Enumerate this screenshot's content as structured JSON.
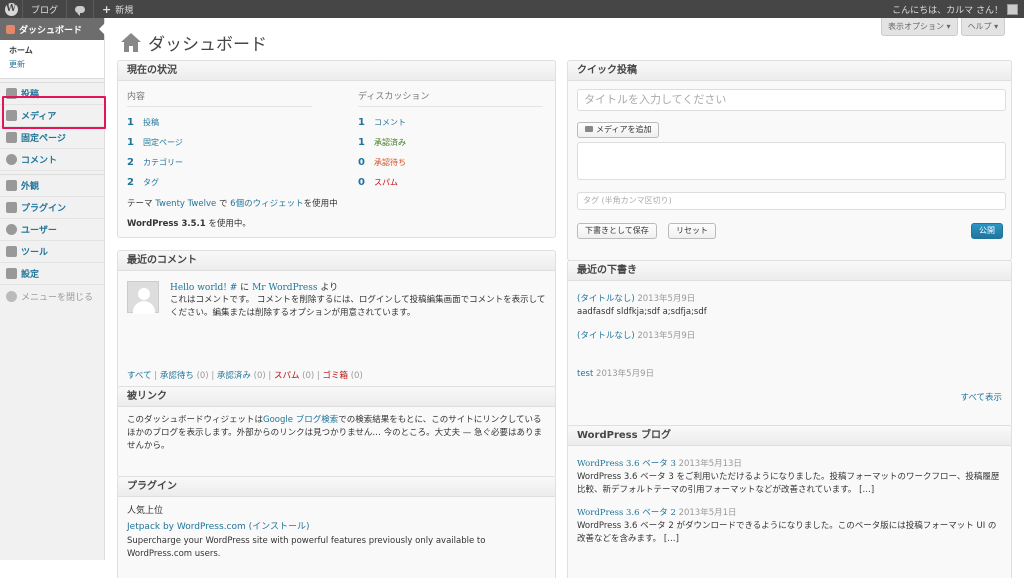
{
  "adminbar": {
    "site_name": "ブログ",
    "new_label": "新規",
    "greeting": "こんにちは、カルマ さん！"
  },
  "sidebar": {
    "current": "ダッシュボード",
    "submenu": [
      "ホーム",
      "更新"
    ],
    "items": [
      {
        "label": "投稿",
        "icon": "pin-icon"
      },
      {
        "label": "メディア",
        "icon": "media-icon"
      },
      {
        "label": "固定ページ",
        "icon": "page-icon"
      },
      {
        "label": "コメント",
        "icon": "comment-icon"
      },
      {
        "label": "外観",
        "icon": "appearance-icon"
      },
      {
        "label": "プラグイン",
        "icon": "plugin-icon"
      },
      {
        "label": "ユーザー",
        "icon": "users-icon"
      },
      {
        "label": "ツール",
        "icon": "tools-icon"
      },
      {
        "label": "設定",
        "icon": "settings-icon"
      }
    ],
    "collapse": "メニューを閉じる"
  },
  "header": {
    "title": "ダッシュボード",
    "screen_options": "表示オプション ▾",
    "help": "ヘルプ ▾"
  },
  "right_now": {
    "title": "現在の状況",
    "content_head": "内容",
    "discussion_head": "ディスカッション",
    "content": [
      {
        "num": "1",
        "label": "投稿"
      },
      {
        "num": "1",
        "label": "固定ページ"
      },
      {
        "num": "2",
        "label": "カテゴリー"
      },
      {
        "num": "2",
        "label": "タグ"
      }
    ],
    "discussion": [
      {
        "num": "1",
        "label": "コメント",
        "color": "#21759b"
      },
      {
        "num": "1",
        "label": "承認済み",
        "color": "#3a7a16"
      },
      {
        "num": "0",
        "label": "承認待ち",
        "color": "#d54e21"
      },
      {
        "num": "0",
        "label": "スパム",
        "color": "#bc0b0b"
      }
    ],
    "theme_prefix": "テーマ",
    "theme_name": "Twenty Twelve",
    "theme_mid": "で",
    "widgets": "6個のウィジェット",
    "theme_suffix": "を使用中",
    "version_bold": "WordPress 3.5.1",
    "version_suffix": "を使用中。"
  },
  "recent_comments": {
    "title": "最近のコメント",
    "post_title": "Hello world! #",
    "ni": "に",
    "author": "Mr WordPress",
    "yori": "より",
    "text": "これはコメントです。 コメントを削除するには、ログインして投稿編集画面でコメントを表示してください。編集または削除するオプションが用意されています。",
    "filters": [
      {
        "label": "すべて",
        "count": "",
        "color": "#21759b"
      },
      {
        "label": "承認待ち",
        "count": "(0)",
        "color": "#21759b"
      },
      {
        "label": "承認済み",
        "count": "(0)",
        "color": "#21759b"
      },
      {
        "label": "スパム",
        "count": "(0)",
        "color": "#bc0b0b"
      },
      {
        "label": "ゴミ箱",
        "count": "(0)",
        "color": "#bc0b0b"
      }
    ]
  },
  "incoming_links": {
    "title": "被リンク",
    "text_a": "このダッシュボードウィジェットは",
    "link": "Google ブログ検索",
    "text_b": "での検索結果をもとに、このサイトにリンクしているほかのブログを表示します。外部からのリンクは見つかりません… 今のところ。大丈夫 — 急ぐ必要はありませんから。"
  },
  "plugins": {
    "title": "プラグイン",
    "section": "人気上位",
    "plugin_name": "Jetpack by WordPress.com",
    "install": "(インストール)",
    "desc": "Supercharge your WordPress site with powerful features previously only available to WordPress.com users."
  },
  "quick_press": {
    "title": "クイック投稿",
    "title_placeholder": "タイトルを入力してください",
    "add_media": "メディアを追加",
    "tags_placeholder": "タグ (半角カンマ区切り)",
    "save_draft": "下書きとして保存",
    "reset": "リセット",
    "publish": "公開"
  },
  "recent_drafts": {
    "title": "最近の下書き",
    "drafts": [
      {
        "title": "(タイトルなし)",
        "date": "2013年5月9日",
        "excerpt": "aadfasdf sldfkja;sdf a;sdfja;sdf"
      },
      {
        "title": "(タイトルなし)",
        "date": "2013年5月9日",
        "excerpt": ""
      },
      {
        "title": "test",
        "date": "2013年5月9日",
        "excerpt": ""
      }
    ],
    "view_all": "すべて表示"
  },
  "wp_blog": {
    "title": "WordPress ブログ",
    "items": [
      {
        "title": "WordPress 3.6 ベータ 3",
        "date": "2013年5月13日",
        "text": "WordPress 3.6 ベータ 3 をご利用いただけるようになりました。投稿フォーマットのワークフロー、投稿履歴比較、新デフォルトテーマの引用フォーマットなどが改善されています。 […]"
      },
      {
        "title": "WordPress 3.6 ベータ 2",
        "date": "2013年5月1日",
        "text": "WordPress 3.6 ベータ 2 がダウンロードできるようになりました。このベータ版には投稿フォーマット UI の改善などを含みます。 […]"
      }
    ]
  }
}
